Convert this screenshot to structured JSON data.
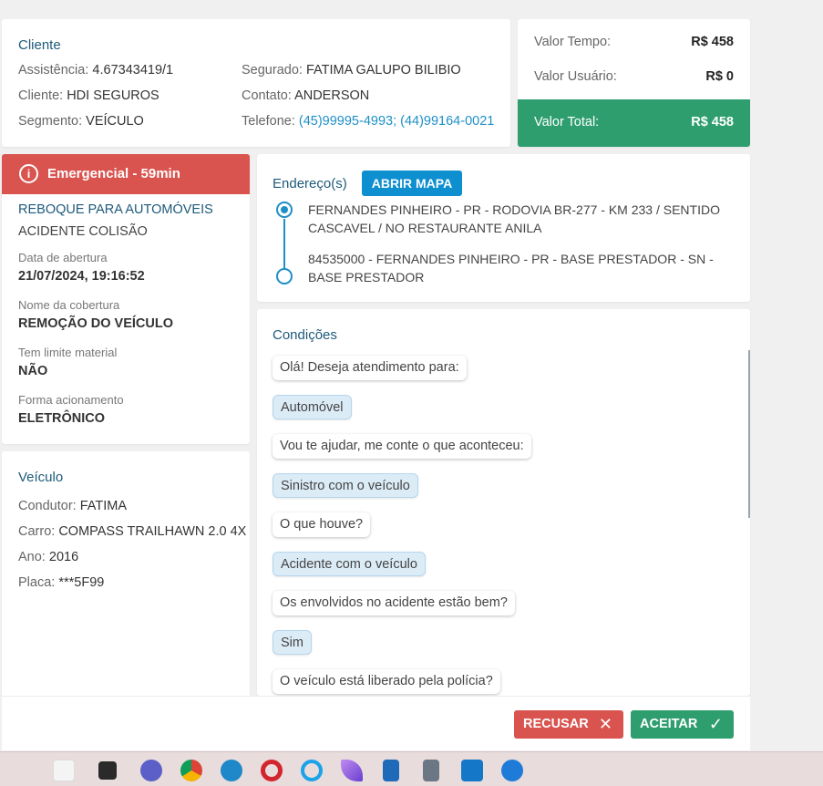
{
  "client": {
    "title": "Cliente",
    "assistencia_k": "Assistência:",
    "assistencia_v": "4.67343419/1",
    "cliente_k": "Cliente:",
    "cliente_v": "HDI SEGUROS",
    "segmento_k": "Segmento:",
    "segmento_v": "VEÍCULO",
    "segurado_k": "Segurado:",
    "segurado_v": "FATIMA GALUPO BILIBIO",
    "contato_k": "Contato:",
    "contato_v": "ANDERSON",
    "telefone_k": "Telefone:",
    "telefone_v": "(45)99995-4993; (44)99164-0021"
  },
  "values": {
    "tempo_label": "Valor Tempo:",
    "tempo_value": "R$ 458",
    "usuario_label": "Valor Usuário:",
    "usuario_value": "R$ 0",
    "total_label": "Valor Total:",
    "total_value": "R$ 458",
    "total_color": "#2e9e6e"
  },
  "service": {
    "emergency": "Emergencial - 59min",
    "emergency_color": "#d9534f",
    "type": "REBOQUE PARA AUTOMÓVEIS",
    "subtype": "ACIDENTE COLISÃO",
    "data_abertura_label": "Data de abertura",
    "data_abertura": "21/07/2024, 19:16:52",
    "cobertura_label": "Nome da cobertura",
    "cobertura": "REMOÇÃO DO VEÍCULO",
    "limite_label": "Tem limite material",
    "limite": "NÃO",
    "acionamento_label": "Forma acionamento",
    "acionamento": "ELETRÔNICO"
  },
  "vehicle": {
    "title": "Veículo",
    "condutor_k": "Condutor:",
    "condutor_v": "FATIMA",
    "carro_k": "Carro:",
    "carro_v": "COMPASS TRAILHAWN 2.0 4X",
    "ano_k": "Ano:",
    "ano_v": "2016",
    "placa_k": "Placa:",
    "placa_v": "***5F99"
  },
  "address": {
    "title": "Endereço(s)",
    "map_button": "ABRIR MAPA",
    "origin": "FERNANDES PINHEIRO - PR - RODOVIA BR-277 - KM 233 / SENTIDO CASCAVEL / NO RESTAURANTE ANILA",
    "destination": "84535000 - FERNANDES PINHEIRO - PR - BASE PRESTADOR - SN - BASE PRESTADOR"
  },
  "conditions": {
    "title": "Condições",
    "messages": [
      {
        "type": "q",
        "text": "Olá! Deseja atendimento para:"
      },
      {
        "type": "a",
        "text": "Automóvel"
      },
      {
        "type": "q",
        "text": "Vou te ajudar, me conte o que aconteceu:"
      },
      {
        "type": "a",
        "text": "Sinistro com o veículo"
      },
      {
        "type": "q",
        "text": "O que houve?"
      },
      {
        "type": "a",
        "text": "Acidente com o veículo"
      },
      {
        "type": "q",
        "text": "Os envolvidos no acidente estão bem?"
      },
      {
        "type": "a",
        "text": "Sim"
      },
      {
        "type": "q",
        "text": "O veículo está liberado pela polícia?"
      }
    ]
  },
  "actions": {
    "reject_label": "RECUSAR",
    "accept_label": "ACEITAR"
  },
  "taskbar": {
    "icons": [
      "weather-icon",
      "terminal-icon",
      "teams-icon",
      "chrome-icon",
      "edge-icon",
      "opera-icon",
      "app-icon",
      "feather-icon",
      "notepad-icon",
      "calculator-icon",
      "anydesk-icon",
      "phone-icon"
    ]
  }
}
